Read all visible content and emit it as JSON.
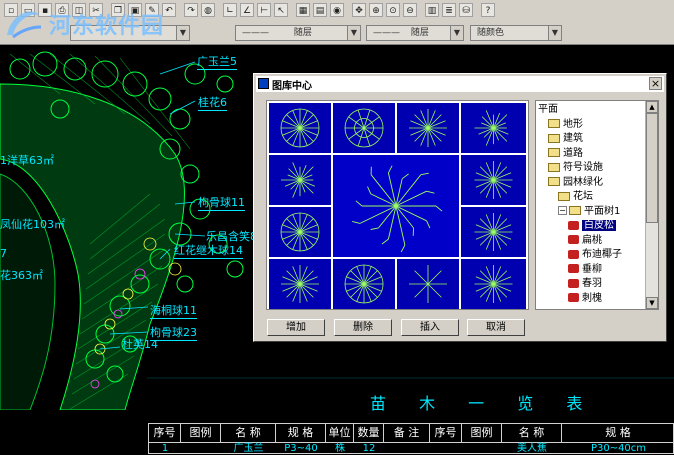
{
  "toolbar": {
    "icons": [
      "new-icon",
      "open-icon",
      "save-icon",
      "print-icon",
      "preview-icon",
      "cut-icon",
      "copy-icon",
      "paste-icon",
      "match-icon",
      "undo-icon",
      "redo-icon",
      "globe-icon",
      "line-icon",
      "angle-icon",
      "dimension-icon",
      "pick-icon",
      "window-icon",
      "layout-icon",
      "eye-icon",
      "pan-icon",
      "zoom-in-icon",
      "zoom-window-icon",
      "zoom-previous-icon",
      "properties-icon",
      "layers-icon",
      "database-icon",
      "help-icon"
    ],
    "help_label": "?"
  },
  "properties_bar": {
    "layer_value": "",
    "linetype_value": "随层",
    "lineweight_value": "随层",
    "color_value": "随颜色",
    "dash_sample": "———"
  },
  "watermark": {
    "text": "河东软件园"
  },
  "cad": {
    "labels": [
      "广玉兰5",
      "桂花6",
      "1洋草63㎡",
      "枸骨球11",
      "乐昌含笑8",
      "红花继木球14",
      "凤仙花103㎡",
      "7",
      "花363㎡",
      "海桐球11",
      "枸骨球23",
      "杜英14"
    ],
    "table_title": "苗 木 一 览 表",
    "table_headers": [
      "序号",
      "图例",
      "名 称",
      "规 格",
      "单位",
      "数量",
      "备 注",
      "序号",
      "图例",
      "名 称",
      "规 格"
    ],
    "table_row": [
      "1",
      "",
      "广玉兰",
      "P3~40",
      "株",
      "12",
      "",
      "",
      "",
      "美人蕉",
      "P30~40cm"
    ]
  },
  "dialog": {
    "title": "图库中心",
    "close_label": "×",
    "tree": [
      {
        "label": "平面",
        "level": 0,
        "kind": "root"
      },
      {
        "label": "地形",
        "level": 1,
        "kind": "folder"
      },
      {
        "label": "建筑",
        "level": 1,
        "kind": "folder"
      },
      {
        "label": "道路",
        "level": 1,
        "kind": "folder"
      },
      {
        "label": "符号设施",
        "level": 1,
        "kind": "folder"
      },
      {
        "label": "园林绿化",
        "level": 1,
        "kind": "folder"
      },
      {
        "label": "花坛",
        "level": 2,
        "kind": "folder"
      },
      {
        "label": "平面树1",
        "level": 2,
        "kind": "open"
      },
      {
        "label": "白皮松",
        "level": 3,
        "kind": "leaf",
        "selected": true
      },
      {
        "label": "扁桃",
        "level": 3,
        "kind": "leaf"
      },
      {
        "label": "布迪椰子",
        "level": 3,
        "kind": "leaf"
      },
      {
        "label": "垂柳",
        "level": 3,
        "kind": "leaf"
      },
      {
        "label": "春羽",
        "level": 3,
        "kind": "leaf"
      },
      {
        "label": "刺槐",
        "level": 3,
        "kind": "leaf"
      }
    ],
    "buttons": {
      "add": "增加",
      "delete": "删除",
      "insert": "插入",
      "cancel": "取消"
    }
  },
  "colors": {
    "cad_background": "#000000",
    "cad_text": "#00e8ff",
    "plant_green": "#00ff40",
    "gallery_blue": "#0000b0",
    "dialog_face": "#d4d0c8",
    "selection": "#000080"
  }
}
